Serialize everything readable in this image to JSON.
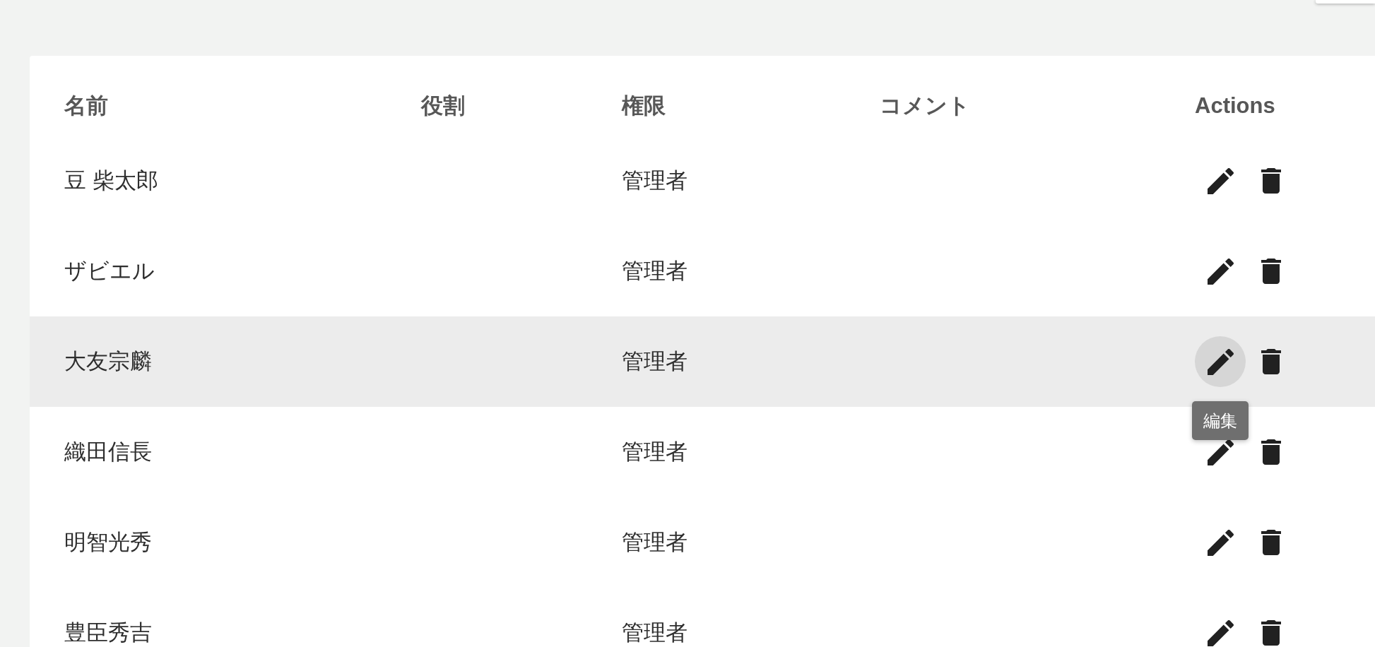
{
  "table": {
    "columns": [
      "名前",
      "役割",
      "権限",
      "コメント",
      "Actions"
    ],
    "rows": [
      {
        "name": "豆 柴太郎",
        "permission": "管理者",
        "hovered": false,
        "actions": [
          {
            "kind": "edit",
            "hovered": false
          },
          {
            "kind": "delete",
            "hovered": false
          }
        ]
      },
      {
        "name": "ザビエル",
        "permission": "管理者",
        "hovered": false,
        "actions": [
          {
            "kind": "edit",
            "hovered": false
          },
          {
            "kind": "delete",
            "hovered": false
          }
        ]
      },
      {
        "name": "大友宗麟",
        "permission": "管理者",
        "hovered": true,
        "actions": [
          {
            "kind": "edit",
            "hovered": true,
            "tooltip": "編集"
          },
          {
            "kind": "delete",
            "hovered": false
          }
        ]
      },
      {
        "name": "織田信長",
        "permission": "管理者",
        "hovered": false,
        "actions": [
          {
            "kind": "edit",
            "hovered": false
          },
          {
            "kind": "delete",
            "hovered": false
          }
        ]
      },
      {
        "name": "明智光秀",
        "permission": "管理者",
        "hovered": false,
        "actions": [
          {
            "kind": "edit",
            "hovered": false
          },
          {
            "kind": "delete",
            "hovered": false
          }
        ]
      },
      {
        "name": "豊臣秀吉",
        "permission": "管理者",
        "hovered": false,
        "actions": [
          {
            "kind": "edit",
            "hovered": false
          },
          {
            "kind": "delete",
            "hovered": false
          }
        ]
      }
    ]
  }
}
